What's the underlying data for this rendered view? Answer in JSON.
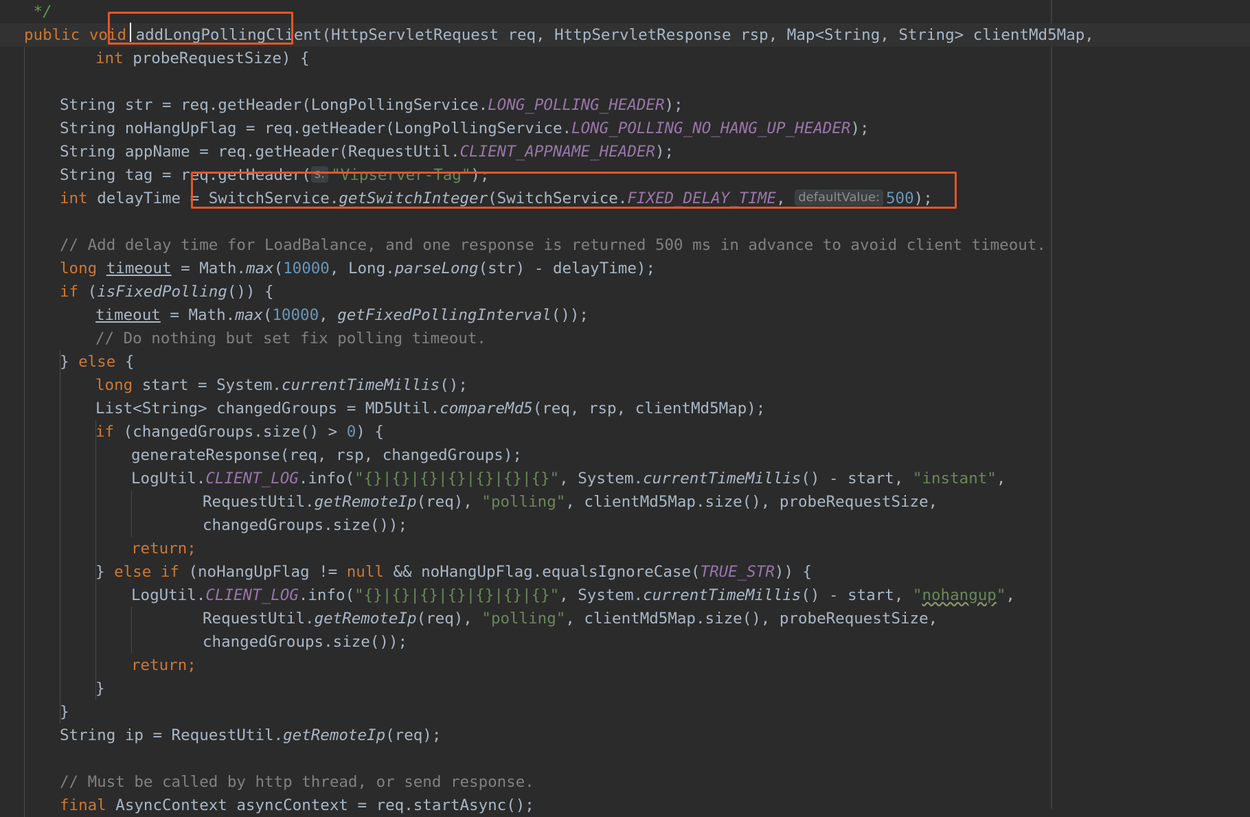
{
  "editor": {
    "lines": [
      {
        "indent": 0,
        "parts": [
          {
            "t": " */",
            "c": "doc-comment"
          }
        ]
      },
      {
        "indent": 0,
        "caret_row": true,
        "parts": [
          {
            "t": "public ",
            "c": "kw"
          },
          {
            "t": "void ",
            "c": "kw"
          },
          {
            "t": "addLongPollingClient",
            "c": "fn"
          },
          {
            "t": "(HttpServletRequest req, HttpServletResponse rsp, Map<String, String> clientMd5Map,"
          }
        ]
      },
      {
        "indent": 2,
        "parts": [
          {
            "t": "int ",
            "c": "kw"
          },
          {
            "t": "probeRequestSize) {"
          }
        ]
      },
      {
        "indent": 0,
        "parts": []
      },
      {
        "indent": 1,
        "parts": [
          {
            "t": "String str = req.getHeader(LongPollingService."
          },
          {
            "t": "LONG_POLLING_HEADER",
            "c": "const"
          },
          {
            "t": ");"
          }
        ]
      },
      {
        "indent": 1,
        "parts": [
          {
            "t": "String noHangUpFlag = req.getHeader(LongPollingService."
          },
          {
            "t": "LONG_POLLING_NO_HANG_UP_HEADER",
            "c": "const"
          },
          {
            "t": ");"
          }
        ]
      },
      {
        "indent": 1,
        "parts": [
          {
            "t": "String appName = req.getHeader(RequestUtil."
          },
          {
            "t": "CLIENT_APPNAME_HEADER",
            "c": "const"
          },
          {
            "t": ");"
          }
        ]
      },
      {
        "indent": 1,
        "parts": [
          {
            "t": "String tag = req.getHeader("
          },
          {
            "t": "s:",
            "c": "hint"
          },
          {
            "t": "\"Vipserver-Tag\"",
            "c": "str"
          },
          {
            "t": ");"
          }
        ]
      },
      {
        "indent": 1,
        "parts": [
          {
            "t": "int ",
            "c": "kw"
          },
          {
            "t": "delayTime = SwitchService."
          },
          {
            "t": "getSwitchInteger",
            "c": "static-call"
          },
          {
            "t": "(SwitchService."
          },
          {
            "t": "FIXED_DELAY_TIME",
            "c": "const"
          },
          {
            "t": ", "
          },
          {
            "t": "defaultValue:",
            "c": "hint"
          },
          {
            "t": "500",
            "c": "num"
          },
          {
            "t": ");"
          }
        ]
      },
      {
        "indent": 0,
        "parts": []
      },
      {
        "indent": 1,
        "parts": [
          {
            "t": "// Add delay time for LoadBalance, and one response is returned 500 ms in advance to avoid client timeout.",
            "c": "comment"
          }
        ]
      },
      {
        "indent": 1,
        "parts": [
          {
            "t": "long ",
            "c": "kw"
          },
          {
            "t": "timeout",
            "c": "ul"
          },
          {
            "t": " = Math."
          },
          {
            "t": "max",
            "c": "static-call"
          },
          {
            "t": "("
          },
          {
            "t": "10000",
            "c": "num"
          },
          {
            "t": ", Long."
          },
          {
            "t": "parseLong",
            "c": "static-call"
          },
          {
            "t": "(str) - delayTime);"
          }
        ]
      },
      {
        "indent": 1,
        "parts": [
          {
            "t": "if ",
            "c": "kw"
          },
          {
            "t": "("
          },
          {
            "t": "isFixedPolling",
            "c": "static-call"
          },
          {
            "t": "()) {"
          }
        ]
      },
      {
        "indent": 2,
        "parts": [
          {
            "t": "timeout",
            "c": "ul"
          },
          {
            "t": " = Math."
          },
          {
            "t": "max",
            "c": "static-call"
          },
          {
            "t": "("
          },
          {
            "t": "10000",
            "c": "num"
          },
          {
            "t": ", "
          },
          {
            "t": "getFixedPollingInterval",
            "c": "static-call"
          },
          {
            "t": "());"
          }
        ]
      },
      {
        "indent": 2,
        "parts": [
          {
            "t": "// Do nothing but set fix polling timeout.",
            "c": "comment"
          }
        ]
      },
      {
        "indent": 1,
        "parts": [
          {
            "t": "} "
          },
          {
            "t": "else ",
            "c": "kw"
          },
          {
            "t": "{"
          }
        ]
      },
      {
        "indent": 2,
        "parts": [
          {
            "t": "long ",
            "c": "kw"
          },
          {
            "t": "start = System."
          },
          {
            "t": "currentTimeMillis",
            "c": "static-call"
          },
          {
            "t": "();"
          }
        ]
      },
      {
        "indent": 2,
        "parts": [
          {
            "t": "List<String> changedGroups = MD5Util."
          },
          {
            "t": "compareMd5",
            "c": "static-call"
          },
          {
            "t": "(req, rsp, clientMd5Map);"
          }
        ]
      },
      {
        "indent": 2,
        "parts": [
          {
            "t": "if ",
            "c": "kw"
          },
          {
            "t": "(changedGroups.size() > "
          },
          {
            "t": "0",
            "c": "num"
          },
          {
            "t": ") {"
          }
        ]
      },
      {
        "indent": 3,
        "parts": [
          {
            "t": "generateResponse(req, rsp, changedGroups);"
          }
        ]
      },
      {
        "indent": 3,
        "parts": [
          {
            "t": "LogUtil."
          },
          {
            "t": "CLIENT_LOG",
            "c": "const"
          },
          {
            "t": ".info("
          },
          {
            "t": "\"{}|{}|{}|{}|{}|{}|{}\"",
            "c": "str"
          },
          {
            "t": ", System."
          },
          {
            "t": "currentTimeMillis",
            "c": "static-call"
          },
          {
            "t": "() - start, "
          },
          {
            "t": "\"instant\"",
            "c": "str"
          },
          {
            "t": ","
          }
        ]
      },
      {
        "indent": 5,
        "parts": [
          {
            "t": "RequestUtil."
          },
          {
            "t": "getRemoteIp",
            "c": "static-call"
          },
          {
            "t": "(req), "
          },
          {
            "t": "\"polling\"",
            "c": "str"
          },
          {
            "t": ", clientMd5Map.size(), probeRequestSize,"
          }
        ]
      },
      {
        "indent": 5,
        "parts": [
          {
            "t": "changedGroups.size());"
          }
        ]
      },
      {
        "indent": 3,
        "parts": [
          {
            "t": "return",
            "c": "kw"
          },
          {
            "t": ";",
            "c": "kw"
          }
        ]
      },
      {
        "indent": 2,
        "parts": [
          {
            "t": "} "
          },
          {
            "t": "else if ",
            "c": "kw"
          },
          {
            "t": "(noHangUpFlag != "
          },
          {
            "t": "null ",
            "c": "kw"
          },
          {
            "t": "&& noHangUpFlag.equalsIgnoreCase("
          },
          {
            "t": "TRUE_STR",
            "c": "const"
          },
          {
            "t": ")) {"
          }
        ]
      },
      {
        "indent": 3,
        "parts": [
          {
            "t": "LogUtil."
          },
          {
            "t": "CLIENT_LOG",
            "c": "const"
          },
          {
            "t": ".info("
          },
          {
            "t": "\"{}|{}|{}|{}|{}|{}|{}\"",
            "c": "str"
          },
          {
            "t": ", System."
          },
          {
            "t": "currentTimeMillis",
            "c": "static-call"
          },
          {
            "t": "() - start, "
          },
          {
            "t": "\"",
            "c": "str"
          },
          {
            "t": "nohangup",
            "c": "str typo"
          },
          {
            "t": "\"",
            "c": "str"
          },
          {
            "t": ","
          }
        ]
      },
      {
        "indent": 5,
        "parts": [
          {
            "t": "RequestUtil."
          },
          {
            "t": "getRemoteIp",
            "c": "static-call"
          },
          {
            "t": "(req), "
          },
          {
            "t": "\"polling\"",
            "c": "str"
          },
          {
            "t": ", clientMd5Map.size(), probeRequestSize,"
          }
        ]
      },
      {
        "indent": 5,
        "parts": [
          {
            "t": "changedGroups.size());"
          }
        ]
      },
      {
        "indent": 3,
        "parts": [
          {
            "t": "return",
            "c": "kw"
          },
          {
            "t": ";",
            "c": "kw"
          }
        ]
      },
      {
        "indent": 2,
        "parts": [
          {
            "t": "}"
          }
        ]
      },
      {
        "indent": 1,
        "parts": [
          {
            "t": "}"
          }
        ]
      },
      {
        "indent": 1,
        "parts": [
          {
            "t": "String ip = RequestUtil."
          },
          {
            "t": "getRemoteIp",
            "c": "static-call"
          },
          {
            "t": "(req);"
          }
        ]
      },
      {
        "indent": 0,
        "parts": []
      },
      {
        "indent": 1,
        "parts": [
          {
            "t": "// Must be called by http thread, or send response.",
            "c": "comment"
          }
        ]
      },
      {
        "indent": 1,
        "parts": [
          {
            "t": "final ",
            "c": "kw"
          },
          {
            "t": "AsyncContext asyncContext = req.startAsync();"
          }
        ]
      }
    ]
  },
  "annotations": {
    "box_color": "#e3562b",
    "highlights": [
      "addLongPollingClient",
      "delay-time-switch-call"
    ]
  }
}
